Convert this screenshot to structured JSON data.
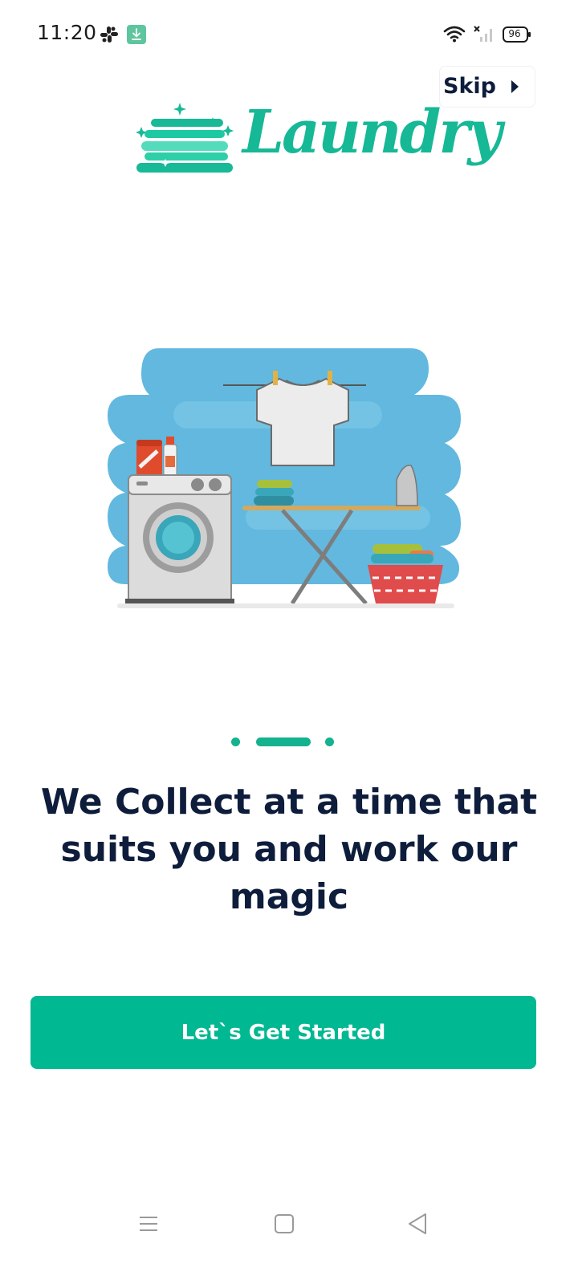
{
  "status_bar": {
    "time": "11:20",
    "battery": "96",
    "icons": [
      "slack-icon",
      "download-icon",
      "wifi-icon",
      "signal-icon",
      "battery-icon"
    ]
  },
  "skip": {
    "label": "Skip",
    "icon": "chevron-right-icon"
  },
  "logo": {
    "word": "Laundry",
    "icon": "folded-towels-icon"
  },
  "pager": {
    "pages": 3,
    "active": 2
  },
  "headline": "We Collect at a time that suits you and work our magic",
  "cta": {
    "label": "Let`s Get Started"
  },
  "nav_bar": {
    "icons": [
      "menu-icon",
      "home-icon",
      "back-icon"
    ]
  },
  "colors": {
    "accent": "#00b892",
    "text_dark": "#0e1d3b",
    "illustration_bg": "#62b8de"
  }
}
